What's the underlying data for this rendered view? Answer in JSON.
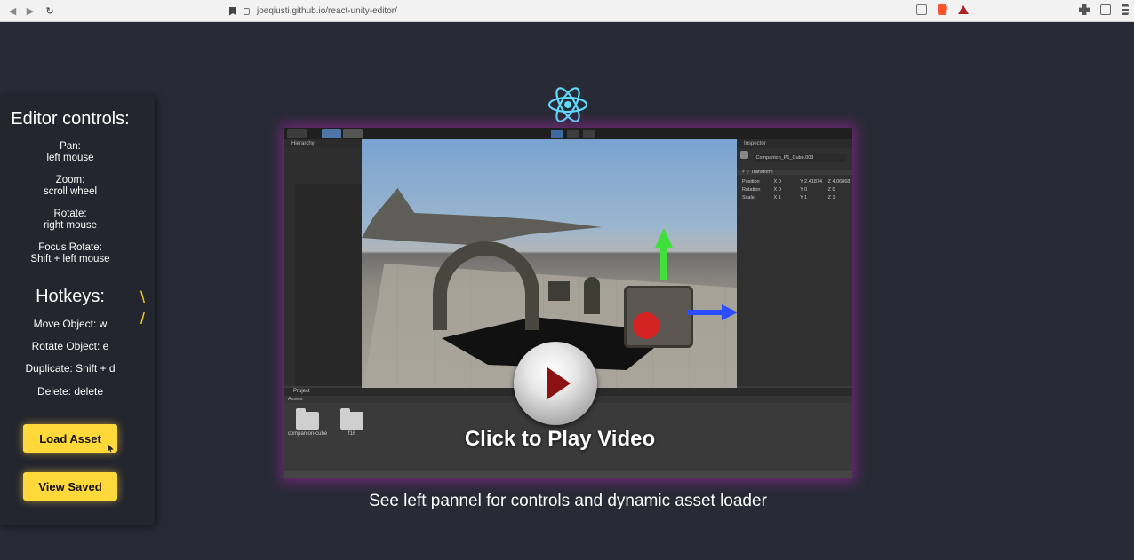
{
  "browser": {
    "url": "joeqiusti.github.io/react-unity-editor/"
  },
  "left_panel": {
    "title": "Editor controls:",
    "controls": [
      {
        "label": "Pan:",
        "value": "left mouse"
      },
      {
        "label": "Zoom:",
        "value": "scroll wheel"
      },
      {
        "label": "Rotate:",
        "value": "right mouse"
      },
      {
        "label": "Focus Rotate:",
        "value": "Shift + left mouse"
      }
    ],
    "hotkeys_title": "Hotkeys:",
    "hotkeys": [
      "Move Object: w",
      "Rotate Object: e",
      "Duplicate: Shift + d",
      "Delete: delete"
    ],
    "load_button": "Load Asset",
    "view_button": "View Saved"
  },
  "editor": {
    "hierarchy_tab": "Hierarchy",
    "inspector_tab": "Inspector",
    "object_name": "Companion_P1_Cube.003",
    "component": "Transform",
    "rows": [
      {
        "label": "Position",
        "x": "X 0",
        "y": "Y 2.41874",
        "z": "Z 4.06868"
      },
      {
        "label": "Rotation",
        "x": "X 0",
        "y": "Y 0",
        "z": "Z 0"
      },
      {
        "label": "Scale",
        "x": "X 1",
        "y": "Y 1",
        "z": "Z 1"
      }
    ],
    "project_tab": "Project",
    "assets_label": "Assets",
    "folders": [
      "companion-cube",
      "f16"
    ]
  },
  "video": {
    "play_label": "Click to Play Video"
  },
  "caption": "See left pannel for controls and dynamic asset loader",
  "colors": {
    "background": "#282a36",
    "button": "#ffd83a",
    "glow": "#aa28aa"
  }
}
